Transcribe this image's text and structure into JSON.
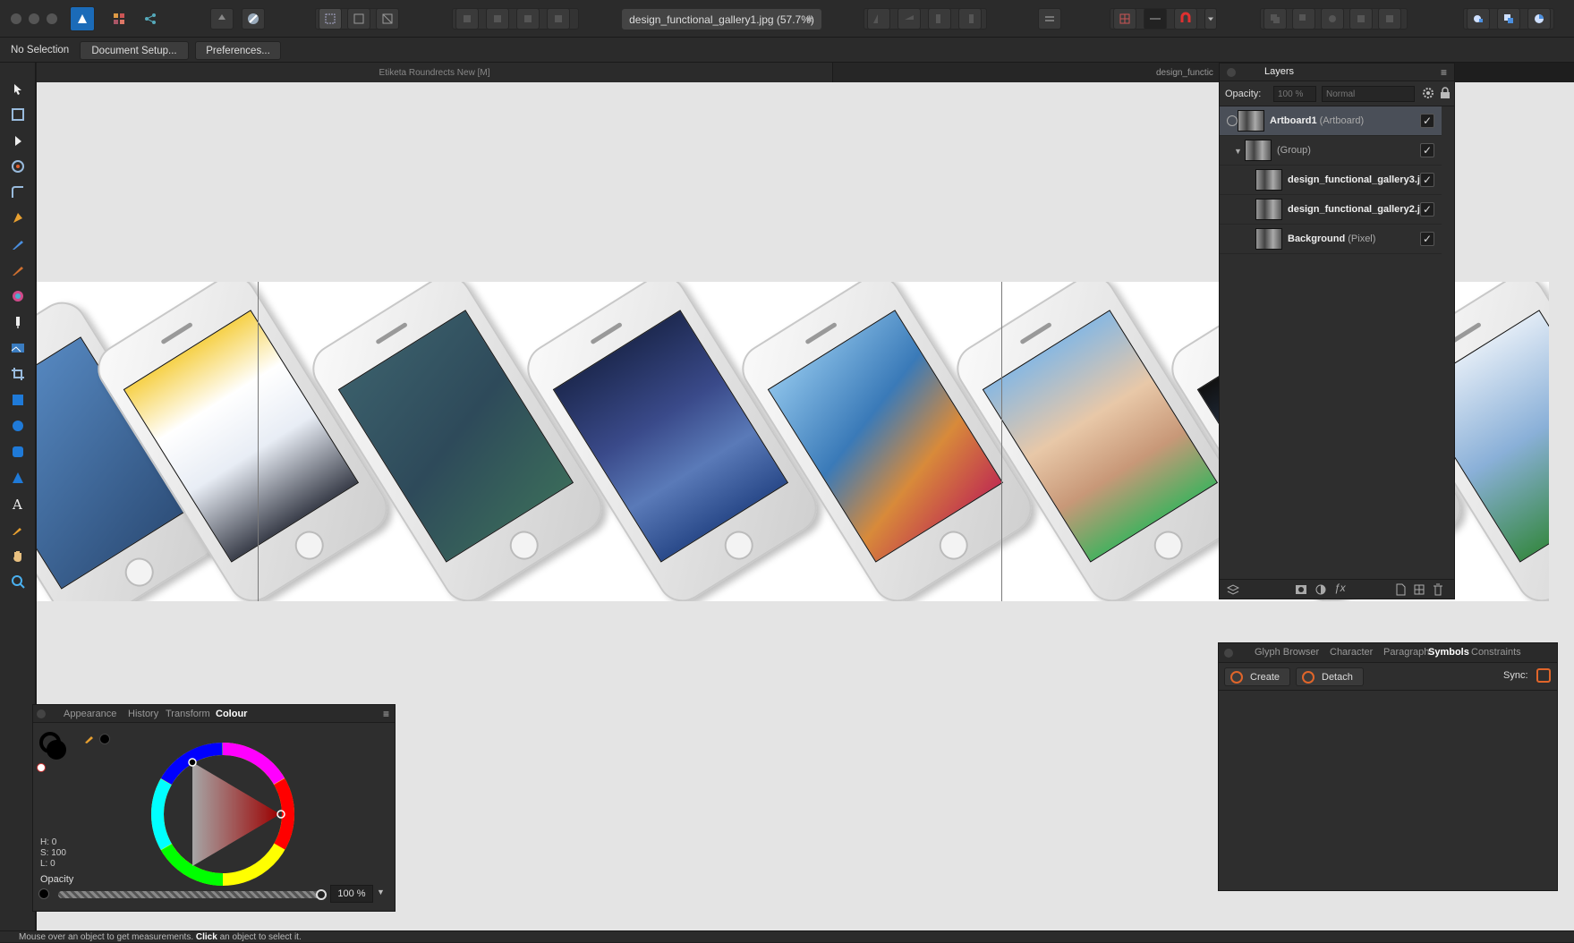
{
  "toolbar": {
    "document_tab": "design_functional_gallery1.jpg (57.7%)",
    "close_star": "★"
  },
  "contextbar": {
    "selection": "No Selection",
    "document_setup": "Document Setup...",
    "preferences": "Preferences..."
  },
  "canvas_tabs": {
    "font_tab": "Etiketa Roundrects New [M]",
    "doc_tab": "design_functic"
  },
  "layers": {
    "panel_title": "Layers",
    "opacity_label": "Opacity:",
    "opacity_value": "100 %",
    "blend_mode": "Normal",
    "rows": [
      {
        "name": "Artboard1",
        "type": "(Artboard)"
      },
      {
        "name": "",
        "type": "(Group)"
      },
      {
        "name": "design_functional_gallery3.j",
        "type": ""
      },
      {
        "name": "design_functional_gallery2.j",
        "type": ""
      },
      {
        "name": "Background",
        "type": "(Pixel)"
      }
    ],
    "check": "✓"
  },
  "symbols": {
    "tabs": [
      "Glyph Browser",
      "Character",
      "Paragraph",
      "Symbols",
      "Constraints"
    ],
    "create": "Create",
    "detach": "Detach",
    "sync": "Sync:"
  },
  "colour": {
    "tabs": [
      "Appearance",
      "History",
      "Transform",
      "Colour"
    ],
    "h": "H: 0",
    "s": "S: 100",
    "l": "L: 0",
    "opacity_label": "Opacity",
    "opacity_value": "100 %"
  },
  "status": {
    "part1": "Mouse over an object to get measurements. ",
    "click": "Click",
    "part2": " an object to select it."
  },
  "colors": {
    "accent_orange": "#e0652a",
    "panel_bg": "#2e2e2e",
    "canvas_bg": "#e4e4e4"
  }
}
